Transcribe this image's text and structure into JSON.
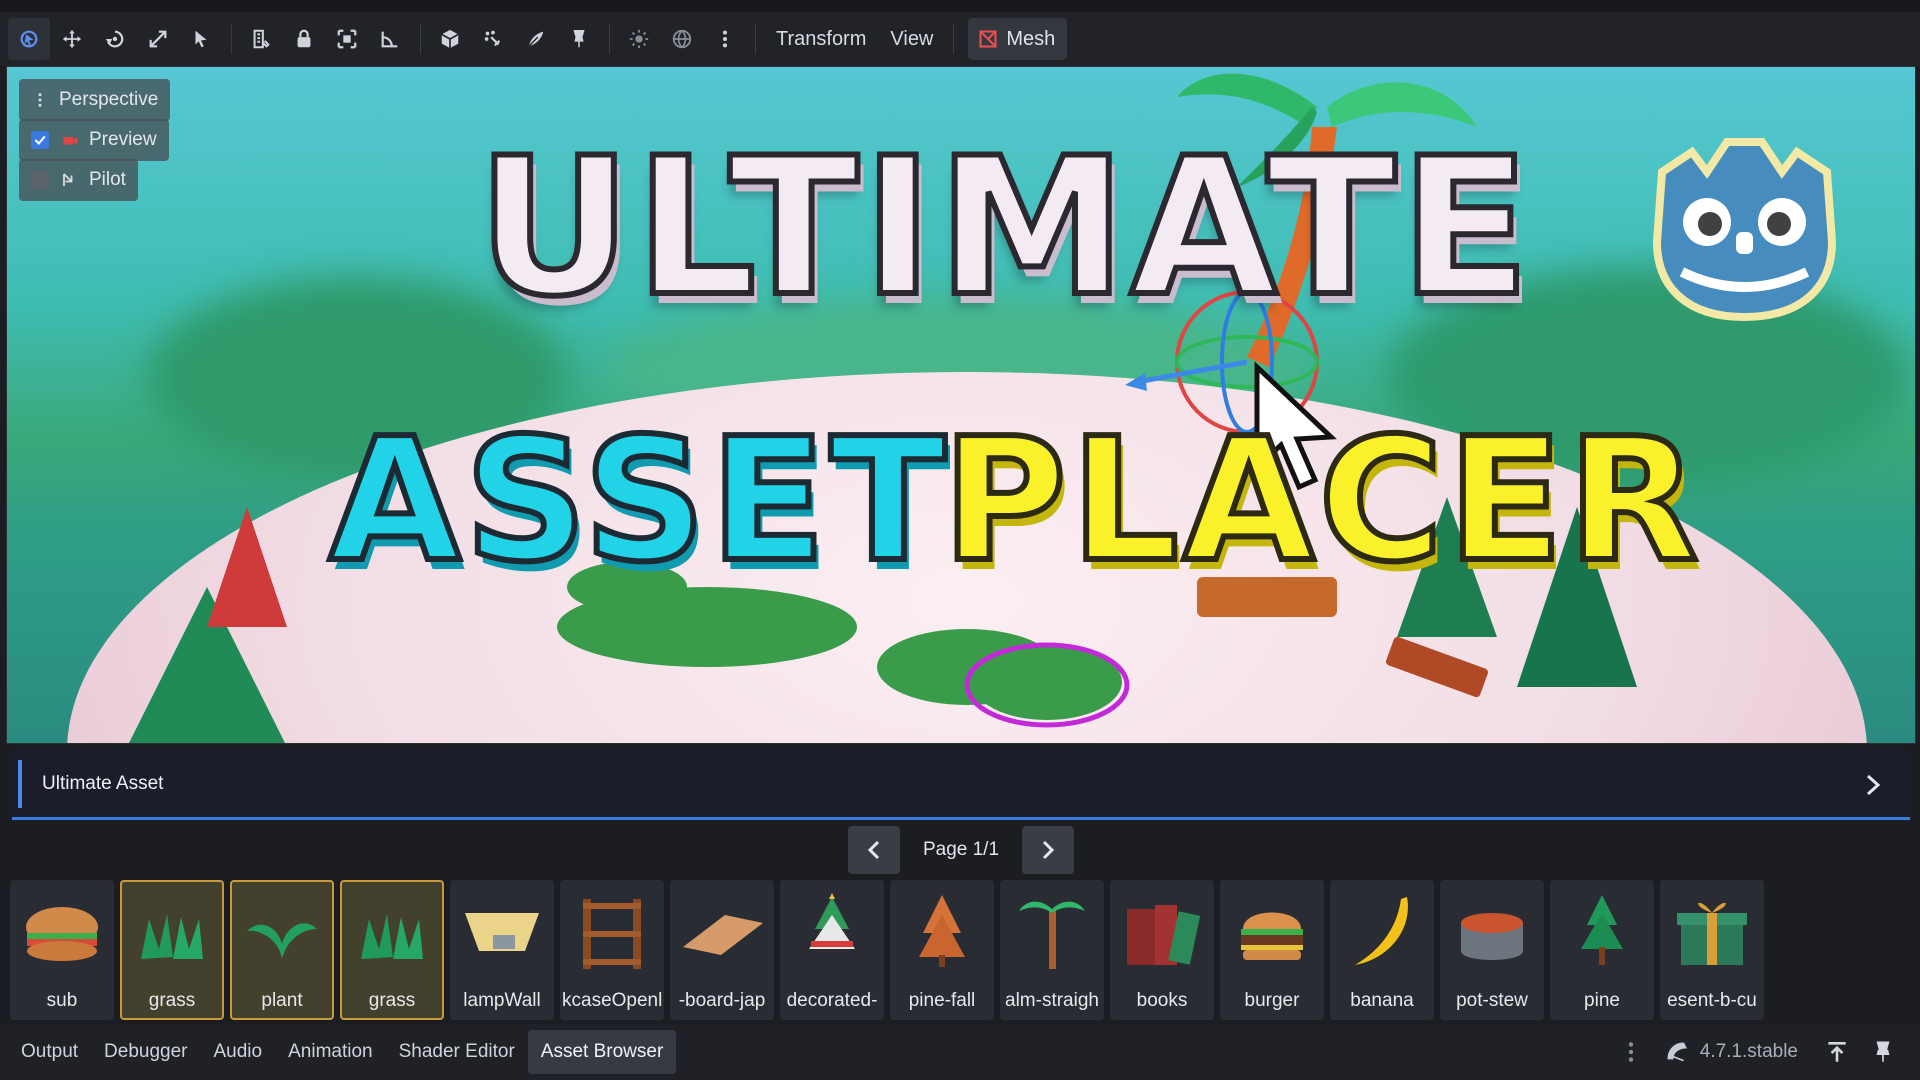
{
  "toolbar": {
    "icons": [
      "select-mode-icon",
      "move-mode-icon",
      "rotate-mode-icon",
      "scale-mode-icon",
      "list-select-icon",
      "ruler-icon",
      "lock-icon",
      "group-icon",
      "snap-icon",
      "local-space-icon",
      "use-snap-icon",
      "particles-icon",
      "camera-icon",
      "sun-icon",
      "environment-icon",
      "more-icon"
    ],
    "transform_label": "Transform",
    "view_label": "View",
    "mesh_label": "Mesh"
  },
  "viewport": {
    "perspective_label": "Perspective",
    "preview_label": "Preview",
    "preview_checked": true,
    "pilot_label": "Pilot",
    "pilot_checked": false,
    "title_line1": "ULTIMATE",
    "title_asset": "ASSET",
    "title_placer": "PLACER",
    "accent_colors": {
      "asset": "#22d3e8",
      "placer": "#fbf12a",
      "logo": "#478cbf"
    }
  },
  "panel": {
    "title": "Ultimate Asset",
    "page_label": "Page 1/1"
  },
  "assets": [
    {
      "label": "sub",
      "icon": "sandwich-icon",
      "selected": false
    },
    {
      "label": "grass",
      "icon": "grass-icon",
      "selected": true
    },
    {
      "label": "plant",
      "icon": "plant-icon",
      "selected": true
    },
    {
      "label": "grass",
      "icon": "grass-icon",
      "selected": true
    },
    {
      "label": "lampWall",
      "icon": "lamp-wall-icon",
      "selected": false
    },
    {
      "label": "kcaseOpenl",
      "icon": "bookcase-icon",
      "selected": false
    },
    {
      "label": "-board-jap",
      "icon": "board-icon",
      "selected": false
    },
    {
      "label": "decorated-",
      "icon": "decorated-tree-icon",
      "selected": false
    },
    {
      "label": "pine-fall",
      "icon": "pine-fall-icon",
      "selected": false
    },
    {
      "label": "alm-straigh",
      "icon": "palm-icon",
      "selected": false
    },
    {
      "label": "books",
      "icon": "books-icon",
      "selected": false
    },
    {
      "label": "burger",
      "icon": "burger-icon",
      "selected": false
    },
    {
      "label": "banana",
      "icon": "banana-icon",
      "selected": false
    },
    {
      "label": "pot-stew",
      "icon": "pot-icon",
      "selected": false
    },
    {
      "label": "pine",
      "icon": "pine-icon",
      "selected": false
    },
    {
      "label": "esent-b-cu",
      "icon": "present-icon",
      "selected": false
    }
  ],
  "bottom": {
    "tabs": [
      {
        "label": "Output",
        "active": false
      },
      {
        "label": "Debugger",
        "active": false
      },
      {
        "label": "Audio",
        "active": false
      },
      {
        "label": "Animation",
        "active": false
      },
      {
        "label": "Shader Editor",
        "active": false
      },
      {
        "label": "Asset Browser",
        "active": true
      }
    ],
    "version": "4.7.1.stable"
  }
}
